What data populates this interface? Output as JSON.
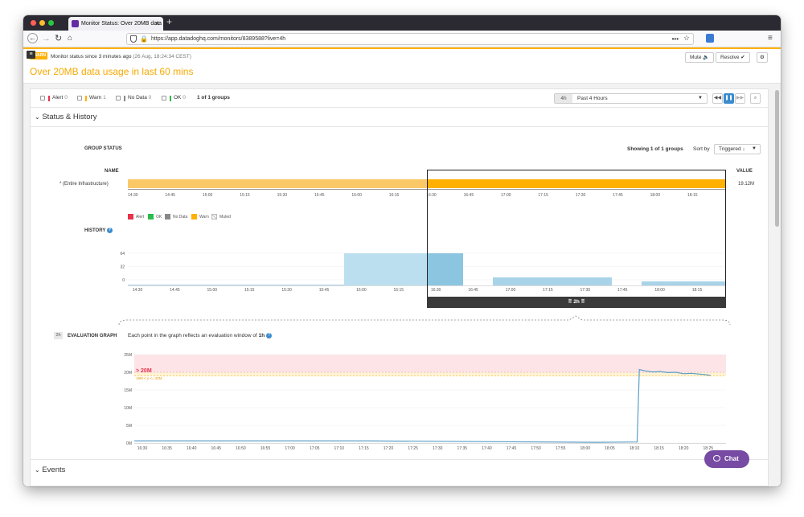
{
  "browser": {
    "tab_title": "Monitor Status: Over 20MB data",
    "url": "https://app.datadoghq.com/monitors/8389588?live=4h"
  },
  "monitor": {
    "status_badge": "WARN",
    "status_since": "Monitor status since 3 minutes ago",
    "status_time": "(26 Aug, 18:24:34 CEST)",
    "title": "Over 20MB data usage in last 60 mins",
    "mute_label": "Mute",
    "resolve_label": "Resolve"
  },
  "filters": {
    "alert_label": "Alert",
    "alert_count": "0",
    "warn_label": "Warn",
    "warn_count": "1",
    "nodata_label": "No Data",
    "nodata_count": "0",
    "ok_label": "OK",
    "ok_count": "0",
    "groups": "1 of 1 groups",
    "time_badge": "4h",
    "time_range": "Past 4 Hours"
  },
  "status_history": {
    "section_title": "Status & History",
    "group_status_label": "GROUP STATUS",
    "showing": "Showing 1 of 1 groups",
    "sort_label": "Sort by",
    "sort_value": "Triggered ↓",
    "name_header": "NAME",
    "value_header": "VALUE",
    "group_name": "* (Entire Infrastructure)",
    "group_value": "19.12M",
    "timeline_ticks": [
      "14:30",
      "14:45",
      "15:00",
      "15:15",
      "15:30",
      "15:45",
      "16:00",
      "16:15",
      "16:30",
      "16:45",
      "17:00",
      "17:15",
      "17:30",
      "17:45",
      "18:00",
      "18:15"
    ],
    "legend": [
      {
        "label": "Alert",
        "color": "#e8334a"
      },
      {
        "label": "OK",
        "color": "#2cbb4a"
      },
      {
        "label": "No Data",
        "color": "#888888"
      },
      {
        "label": "Warn",
        "color": "#ffb000"
      },
      {
        "label": "Muted",
        "color": "#dddddd"
      }
    ],
    "history_label": "HISTORY",
    "history_y_ticks": [
      "64",
      "32",
      "0"
    ],
    "history_x_ticks": [
      "14:30",
      "14:45",
      "15:00",
      "15:15",
      "15:30",
      "15:45",
      "16:00",
      "16:15",
      "16:30",
      "16:45",
      "17:00",
      "17:15",
      "17:30",
      "17:45",
      "18:00",
      "18:15"
    ],
    "selection_label": "2h"
  },
  "evaluation": {
    "badge": "2h",
    "label": "EVALUATION GRAPH",
    "desc_prefix": "Each point in the graph reflects an evaluation window of",
    "desc_window": "1h",
    "threshold_alert": "> 20M",
    "threshold_warn": "19M < y <= 20M",
    "y_ticks": [
      "25M",
      "20M",
      "15M",
      "10M",
      "5M",
      "0M"
    ],
    "x_ticks": [
      "16:30",
      "16:35",
      "16:40",
      "16:45",
      "16:50",
      "16:55",
      "17:00",
      "17:05",
      "17:10",
      "17:15",
      "17:20",
      "17:25",
      "17:30",
      "17:35",
      "17:40",
      "17:45",
      "17:50",
      "17:55",
      "18:00",
      "18:05",
      "18:10",
      "18:15",
      "18:20",
      "18:25"
    ]
  },
  "events": {
    "section_title": "Events"
  },
  "chat": {
    "label": "Chat"
  },
  "colors": {
    "warn": "#ffb000",
    "accent": "#632ca6",
    "series": "#5b9fc9"
  }
}
